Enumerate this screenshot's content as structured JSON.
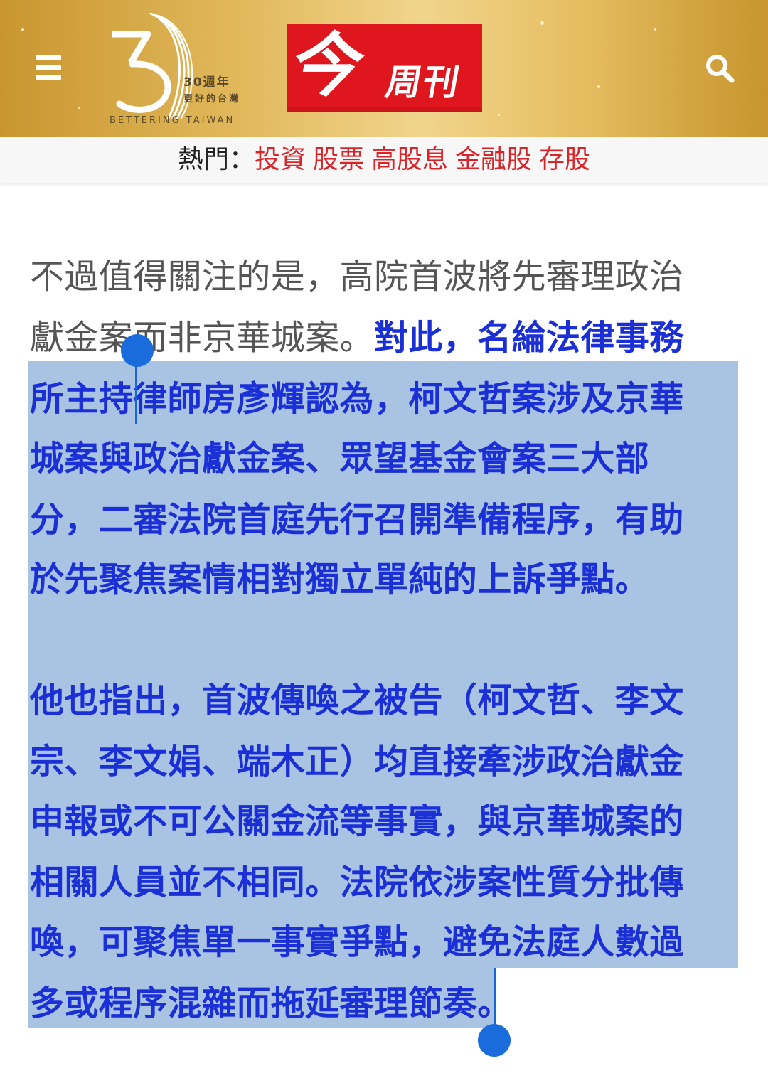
{
  "header": {
    "menu_icon": "hamburger-menu-icon",
    "anniversary": {
      "line1": "30週年",
      "line2": "更好的台灣",
      "line3": "BETTERING TAIWAN"
    },
    "brand": {
      "main": "今",
      "sub": "周刊"
    },
    "search_icon": "search-icon",
    "colors": {
      "gold": "#d9ac4a",
      "brand_red": "#e0161e"
    }
  },
  "hot": {
    "label": "熱門：",
    "links": [
      "投資",
      "股票",
      "高股息",
      "金融股",
      "存股"
    ],
    "link_color": "#d9252a"
  },
  "article": {
    "para1": {
      "line1": "不過值得關注的是，高院首波將先審理政治",
      "line2_plain": "獻金案而非京華城案。",
      "line2_bold": "對此，名綸法律事務",
      "line3": "所主持律師房彥輝認為，柯文哲案涉及京華",
      "line4": "城案與政治獻金案、眾望基金會案三大部",
      "line5": "分，二審法院首庭先行召開準備程序，有助",
      "line6": "於先聚焦案情相對獨立單純的上訴爭點。"
    },
    "para2": {
      "line1": "他也指出，首波傳喚之被告（柯文哲、李文",
      "line2": "宗、李文娟、端木正）均直接牽涉政治獻金",
      "line3": "申報或不可公關金流等事實，與京華城案的",
      "line4": "相關人員並不相同。法院依涉案性質分批傳",
      "line5": "喚，可聚焦單一事實爭點，避免法庭人數過",
      "line6": "多或程序混雜而拖延審理節奏。"
    },
    "bold_color": "#1a2fd6",
    "selection_color": "#a9c3e3"
  }
}
